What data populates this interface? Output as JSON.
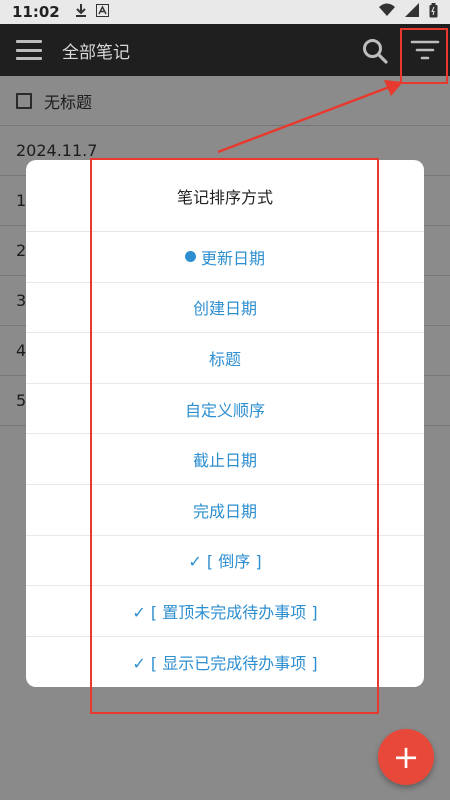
{
  "status_bar": {
    "time": "11:02",
    "icons": [
      "download-icon",
      "font-icon",
      "wifi-icon",
      "signal-icon",
      "battery-icon"
    ]
  },
  "app_bar": {
    "title": "全部笔记",
    "icons": [
      "menu-icon",
      "search-icon",
      "filter-icon"
    ]
  },
  "notes": [
    {
      "title": "无标题",
      "has_checkbox": true
    },
    {
      "title": "2024.11.7"
    },
    {
      "title": "1"
    },
    {
      "title": "2"
    },
    {
      "title": "3"
    },
    {
      "title": "4"
    },
    {
      "title": "5"
    }
  ],
  "dialog": {
    "title": "笔记排序方式",
    "options": [
      {
        "label": "更新日期",
        "selected": true
      },
      {
        "label": "创建日期"
      },
      {
        "label": "标题"
      },
      {
        "label": "自定义顺序"
      },
      {
        "label": "截止日期"
      },
      {
        "label": "完成日期"
      },
      {
        "label": "✓ [ 倒序 ]"
      },
      {
        "label": "✓ [ 置顶未完成待办事项 ]"
      },
      {
        "label": "✓ [ 显示已完成待办事项 ]"
      }
    ]
  },
  "fab": {
    "label": "+"
  },
  "colors": {
    "accent": "#2e8fd0",
    "fab": "#e8483a",
    "annotation": "#e8392e",
    "app_bar": "#1f1f1f"
  }
}
